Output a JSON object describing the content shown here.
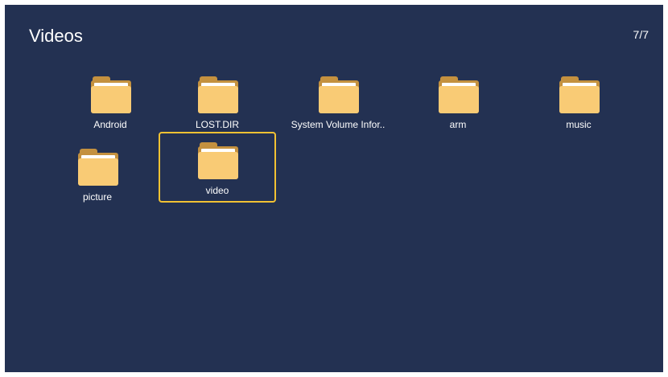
{
  "header": {
    "title": "Videos",
    "page_counter": "7/7"
  },
  "folders": [
    {
      "label": "Android",
      "icon": "folder-icon"
    },
    {
      "label": "LOST.DIR",
      "icon": "folder-icon"
    },
    {
      "label": "System Volume Infor..",
      "icon": "folder-icon"
    },
    {
      "label": "arm",
      "icon": "folder-icon"
    },
    {
      "label": "music",
      "icon": "folder-icon"
    },
    {
      "label": "picture",
      "icon": "folder-icon"
    },
    {
      "label": "video",
      "icon": "folder-icon",
      "selected": true
    }
  ],
  "colors": {
    "background": "#233152",
    "selection_border": "#f2c233",
    "folder_front": "#f9cb75",
    "folder_back": "#c4913f"
  }
}
